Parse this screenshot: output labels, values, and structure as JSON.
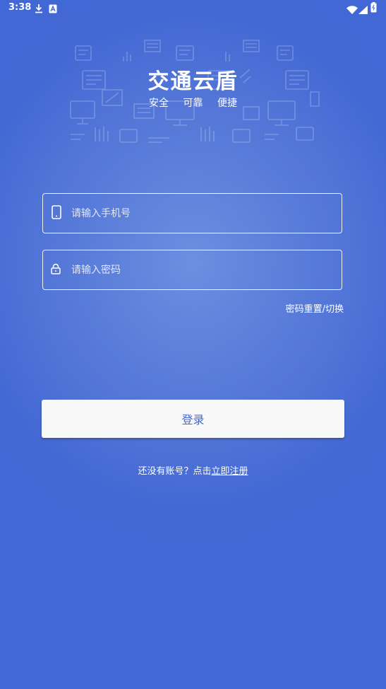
{
  "status_bar": {
    "time": "3:38",
    "icons": [
      "download-icon",
      "a-badge-icon",
      "wifi-icon",
      "signal-icon",
      "battery-icon"
    ]
  },
  "header": {
    "title": "交通云盾",
    "subtitle": [
      "安全",
      "可靠",
      "便捷"
    ]
  },
  "form": {
    "phone_placeholder": "请输入手机号",
    "password_placeholder": "请输入密码",
    "reset_link": "密码重置/切换",
    "login_label": "登录"
  },
  "register": {
    "prompt": "还没有账号？点击",
    "link": "立即注册"
  },
  "colors": {
    "background": "#4168d6",
    "button_bg": "#f8f8f9",
    "button_text": "#4168d6"
  }
}
